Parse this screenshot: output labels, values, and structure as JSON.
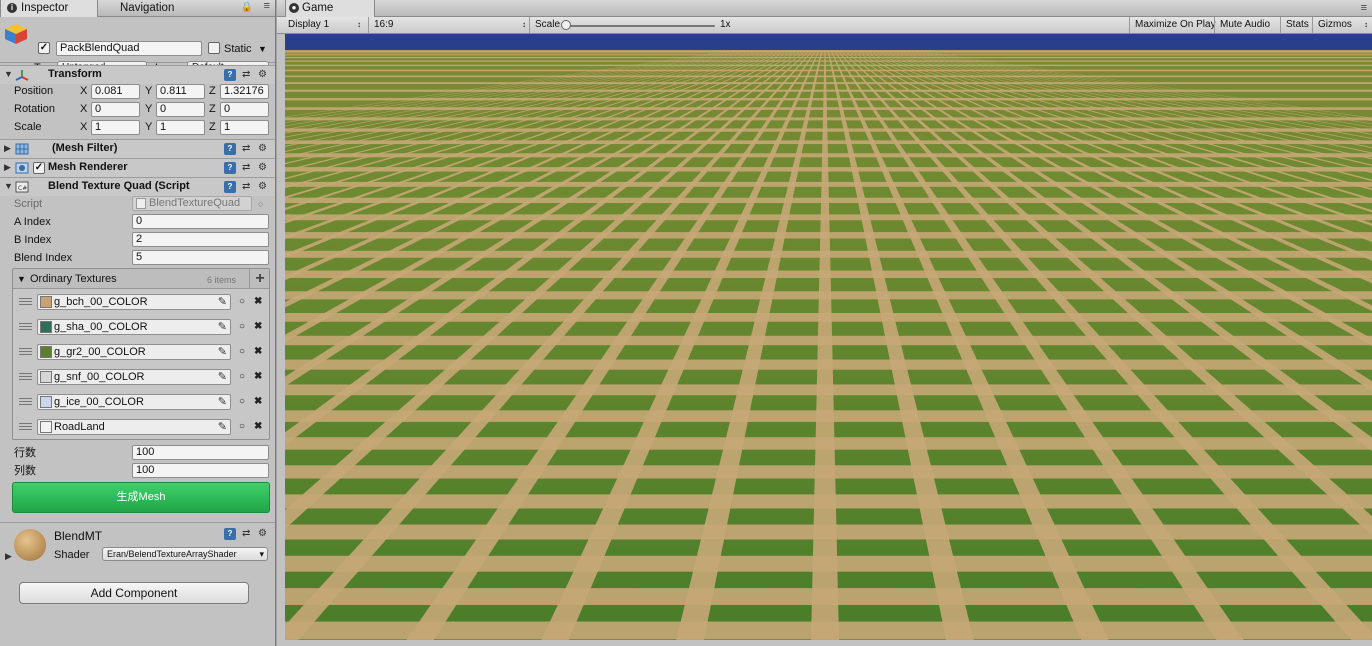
{
  "inspector": {
    "tabs": [
      {
        "label": "Inspector",
        "active": true
      },
      {
        "label": "Navigation",
        "active": false
      }
    ],
    "gameobject": {
      "active": true,
      "name": "PackBlendQuad",
      "static_label": "Static",
      "static_checked": false,
      "tag_label": "Tag",
      "tag_value": "Untagged",
      "layer_label": "Layer",
      "layer_value": "Default"
    },
    "transform": {
      "title": "Transform",
      "rows": [
        {
          "label": "Position",
          "x": "0.081",
          "y": "0.811",
          "z": "1.32176"
        },
        {
          "label": "Rotation",
          "x": "0",
          "y": "0",
          "z": "0"
        },
        {
          "label": "Scale",
          "x": "1",
          "y": "1",
          "z": "1"
        }
      ],
      "axis_x": "X",
      "axis_y": "Y",
      "axis_z": "Z"
    },
    "mesh_filter": {
      "title": "(Mesh Filter)"
    },
    "mesh_renderer": {
      "title": "Mesh Renderer",
      "enabled": true
    },
    "blend_script": {
      "title": "Blend Texture Quad (Script",
      "script_label": "Script",
      "script_value": "BlendTextureQuad",
      "a_index_label": "A Index",
      "a_index": "0",
      "b_index_label": "B Index",
      "b_index": "2",
      "blend_index_label": "Blend Index",
      "blend_index": "5",
      "list_title": "Ordinary Textures",
      "list_count": "6 items",
      "textures": [
        {
          "name": "g_bch_00_COLOR",
          "color": "#c9a273"
        },
        {
          "name": "g_sha_00_COLOR",
          "color": "#2f6e5a"
        },
        {
          "name": "g_gr2_00_COLOR",
          "color": "#5b7f2e"
        },
        {
          "name": "g_snf_00_COLOR",
          "color": "#d6d6d6"
        },
        {
          "name": "g_ice_00_COLOR",
          "color": "#c9d6ee"
        },
        {
          "name": "RoadLand",
          "color": "#f2f2f2"
        }
      ],
      "rows_label": "行数",
      "rows_value": "100",
      "cols_label": "列数",
      "cols_value": "100",
      "generate_label": "生成Mesh"
    },
    "material": {
      "name": "BlendMT",
      "shader_label": "Shader",
      "shader_value": "Eran/BelendTextureArrayShader"
    },
    "add_component_label": "Add Component"
  },
  "game": {
    "tab_label": "Game",
    "display": "Display 1",
    "aspect": "16:9",
    "scale_label": "Scale",
    "scale_value": "1x",
    "maximize": "Maximize On Play",
    "mute": "Mute Audio",
    "stats": "Stats",
    "gizmos": "Gizmos",
    "colors": {
      "sky": "#2a3f8a",
      "grass_far": "#7a8a35",
      "grass": "#3f7f28",
      "path": "#c7a777"
    }
  }
}
